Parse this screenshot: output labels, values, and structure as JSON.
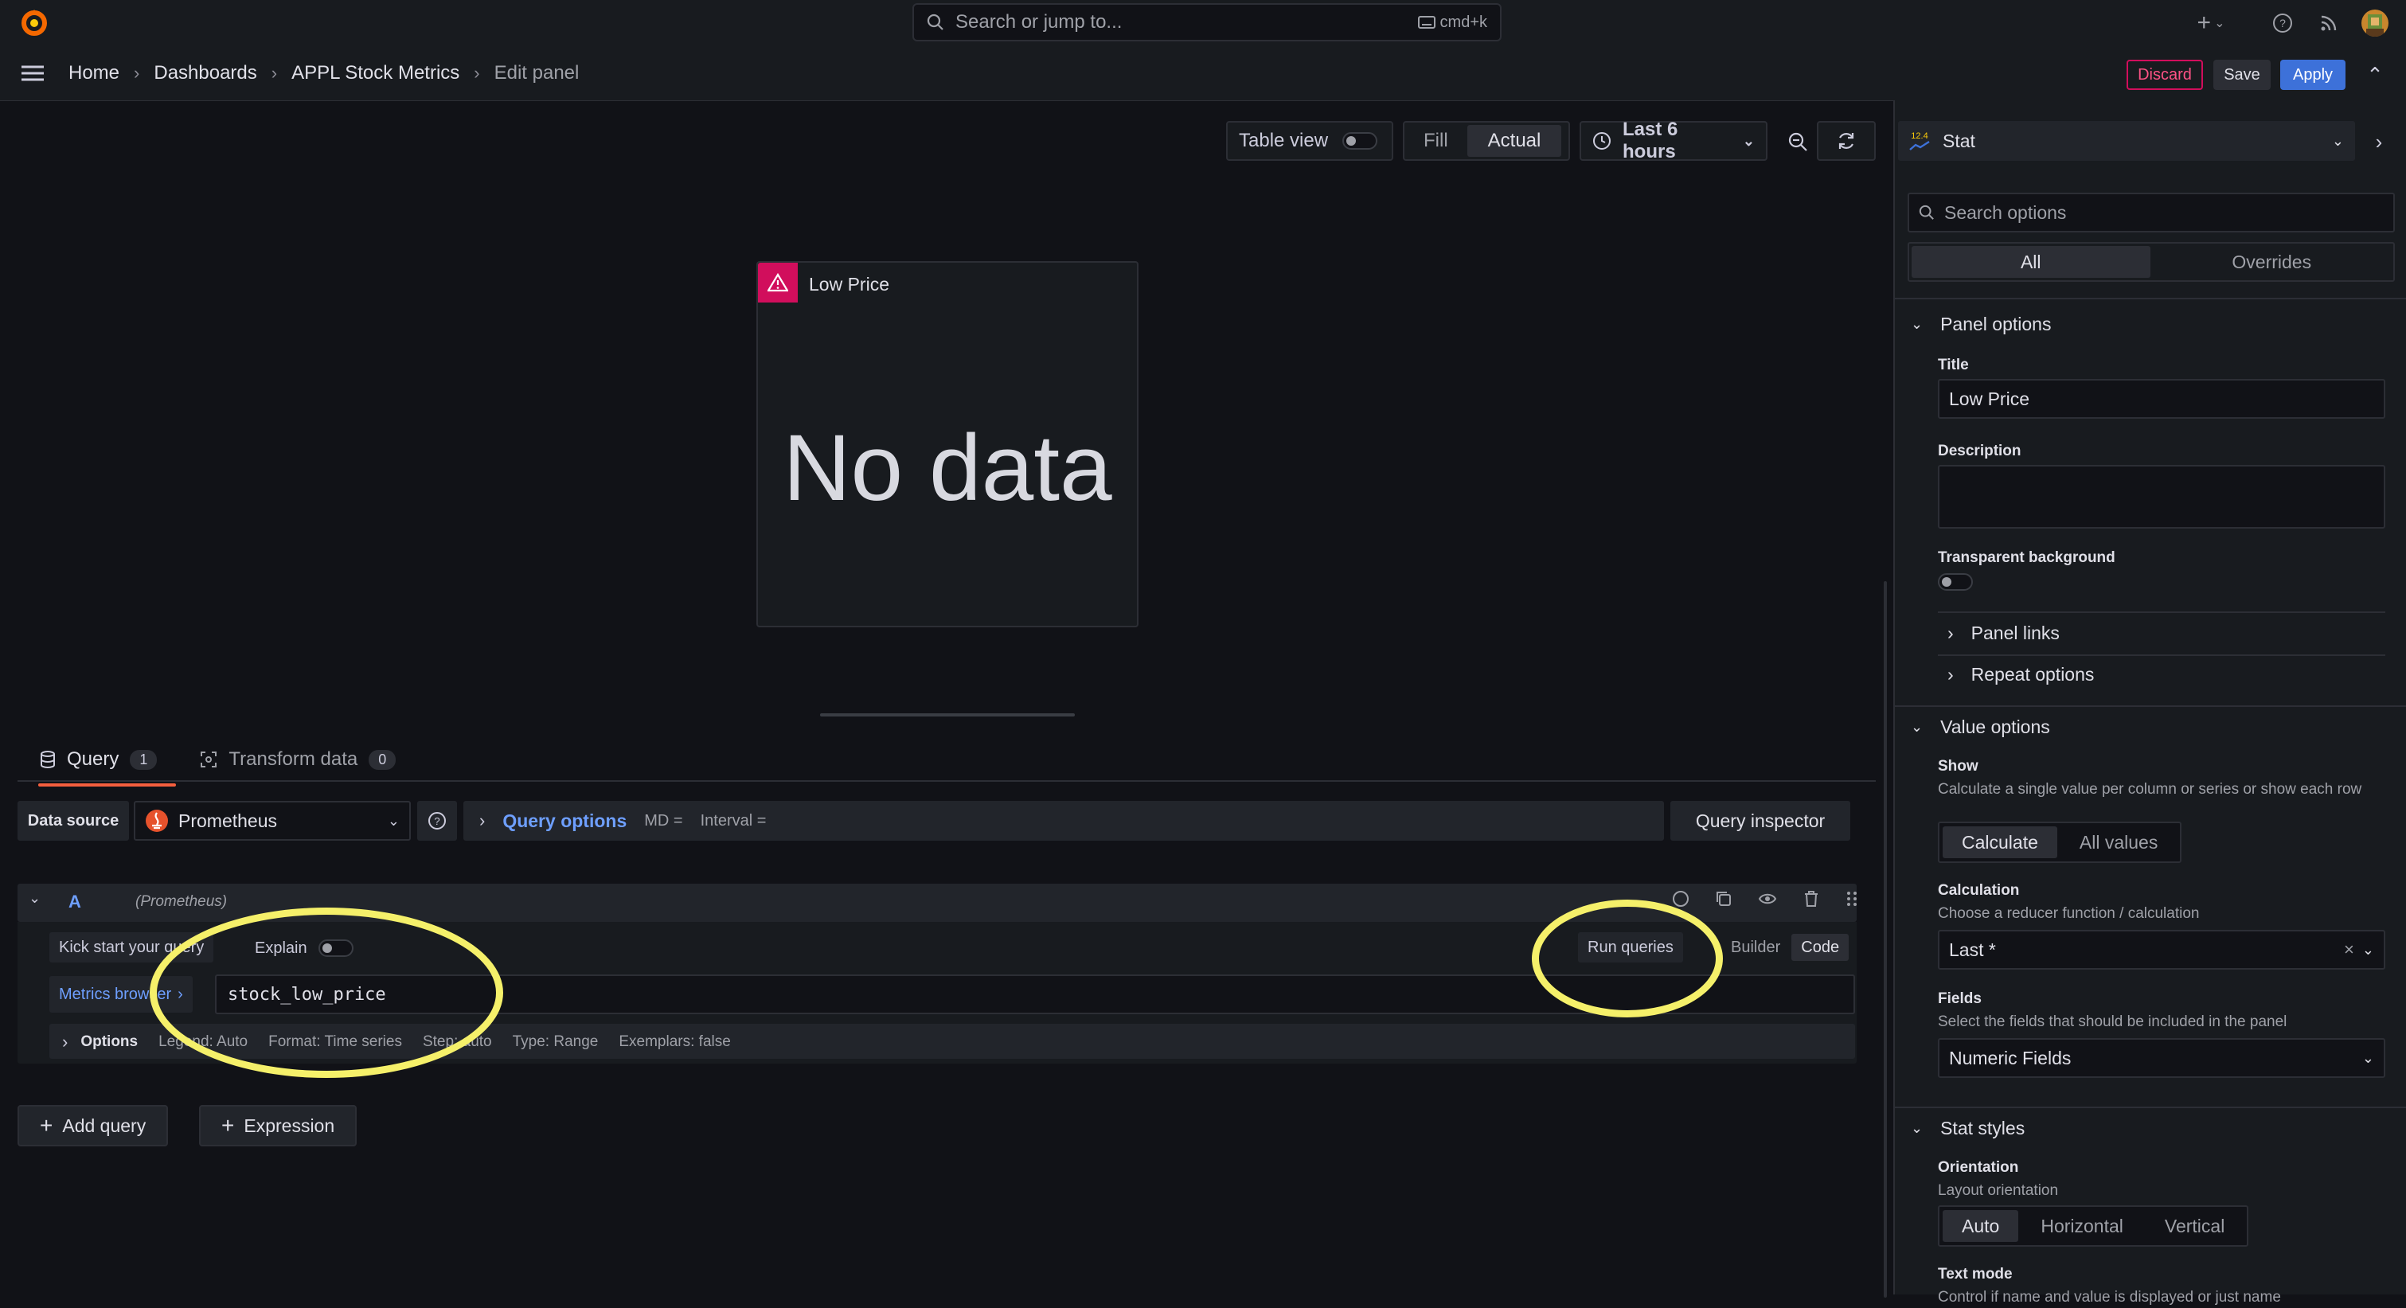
{
  "topbar": {
    "search_placeholder": "Search or jump to...",
    "search_shortcut": "cmd+k"
  },
  "breadcrumbs": [
    "Home",
    "Dashboards",
    "APPL Stock Metrics",
    "Edit panel"
  ],
  "actions": {
    "discard": "Discard",
    "save": "Save",
    "apply": "Apply"
  },
  "panel_toolbar": {
    "table_view": "Table view",
    "fill": "Fill",
    "actual": "Actual",
    "time_range": "Last 6 hours"
  },
  "panel": {
    "title": "Low Price",
    "message": "No data"
  },
  "query_tabs": [
    {
      "label": "Query",
      "count": "1"
    },
    {
      "label": "Transform data",
      "count": "0"
    }
  ],
  "datasource": {
    "label": "Data source",
    "value": "Prometheus",
    "query_options": "Query options",
    "md": "MD =",
    "interval": "Interval =",
    "inspector": "Query inspector"
  },
  "query": {
    "ref": "A",
    "ds_hint": "(Prometheus)",
    "kick_start": "Kick start your query",
    "explain": "Explain",
    "run": "Run queries",
    "builder": "Builder",
    "code": "Code",
    "metrics_browser": "Metrics browser",
    "expression": "stock_low_price",
    "options_label": "Options",
    "legend": "Legend: Auto",
    "format": "Format: Time series",
    "step": "Step: auto",
    "type": "Type: Range",
    "exemplars": "Exemplars: false"
  },
  "add": {
    "query": "Add query",
    "expression": "Expression"
  },
  "options_pane": {
    "visualization": "Stat",
    "viz_icon_text": "12.4",
    "search_placeholder": "Search options",
    "tabs": [
      "All",
      "Overrides"
    ],
    "panel_options": {
      "title": "Panel options",
      "title_label": "Title",
      "title_value": "Low Price",
      "description_label": "Description",
      "transparent_label": "Transparent background",
      "panel_links": "Panel links",
      "repeat_options": "Repeat options"
    },
    "value_options": {
      "title": "Value options",
      "show_label": "Show",
      "show_desc": "Calculate a single value per column or series or show each row",
      "show_opts": [
        "Calculate",
        "All values"
      ],
      "calc_label": "Calculation",
      "calc_desc": "Choose a reducer function / calculation",
      "calc_value": "Last *",
      "fields_label": "Fields",
      "fields_desc": "Select the fields that should be included in the panel",
      "fields_value": "Numeric Fields"
    },
    "stat_styles": {
      "title": "Stat styles",
      "orientation_label": "Orientation",
      "orientation_desc": "Layout orientation",
      "orientation_opts": [
        "Auto",
        "Horizontal",
        "Vertical"
      ],
      "text_mode_label": "Text mode",
      "text_mode_desc": "Control if name and value is displayed or just name"
    }
  },
  "colors": {
    "accent": "#3d71d9",
    "danger": "#d10e5c",
    "highlight": "#f5f06a",
    "tab_active": "#f55f3e"
  }
}
